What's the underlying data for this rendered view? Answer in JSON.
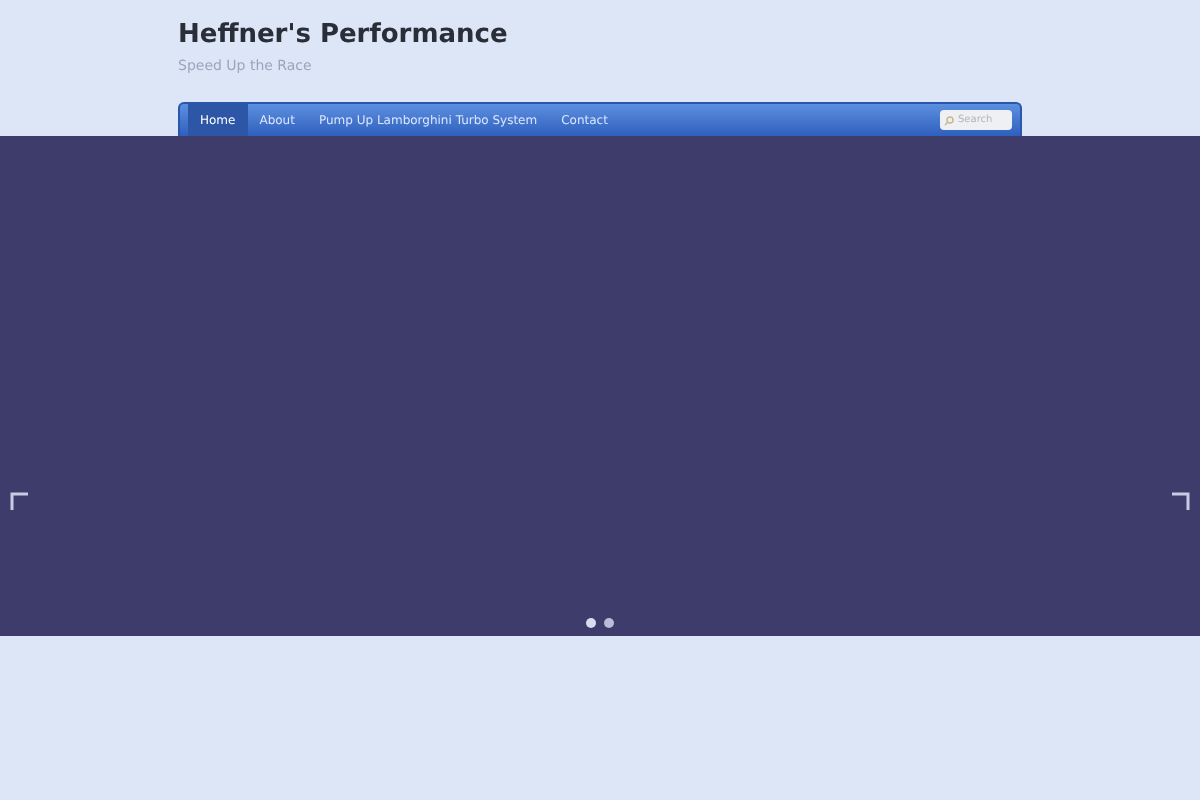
{
  "site": {
    "title": "Heffner's Performance",
    "tagline": "Speed Up the Race"
  },
  "nav": {
    "items": [
      {
        "label": "Home",
        "selected": true
      },
      {
        "label": "About",
        "selected": false
      },
      {
        "label": "Pump Up Lamborghini Turbo System",
        "selected": false
      },
      {
        "label": "Contact",
        "selected": false
      }
    ],
    "search": {
      "placeholder": "Search"
    }
  },
  "slider": {
    "dots": [
      {
        "selected": true
      },
      {
        "selected": false
      }
    ]
  }
}
